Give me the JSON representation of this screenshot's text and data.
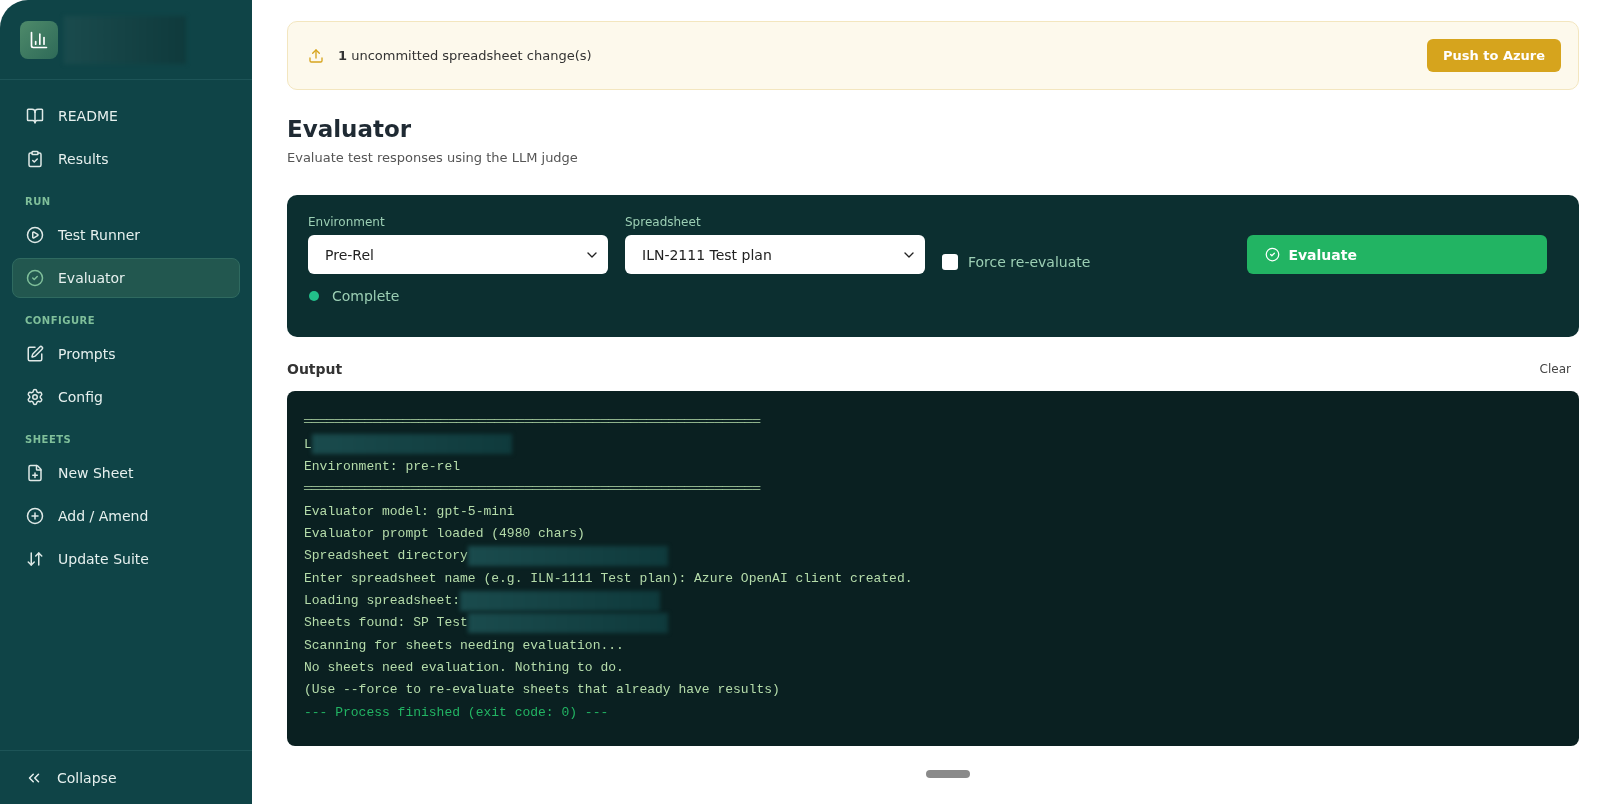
{
  "sidebar": {
    "sections": [
      {
        "items": [
          {
            "label": "README",
            "selected": false
          },
          {
            "label": "Results",
            "selected": false
          }
        ]
      },
      {
        "heading": "RUN",
        "items": [
          {
            "label": "Test Runner",
            "selected": false
          },
          {
            "label": "Evaluator",
            "selected": true
          }
        ]
      },
      {
        "heading": "CONFIGURE",
        "items": [
          {
            "label": "Prompts",
            "selected": false
          },
          {
            "label": "Config",
            "selected": false
          }
        ]
      },
      {
        "heading": "SHEETS",
        "items": [
          {
            "label": "New Sheet",
            "selected": false
          },
          {
            "label": "Add / Amend",
            "selected": false
          },
          {
            "label": "Update Suite",
            "selected": false
          }
        ]
      }
    ],
    "collapse": "Collapse"
  },
  "banner": {
    "count": "1",
    "text": "uncommitted spreadsheet change(s)",
    "button": "Push to Azure"
  },
  "page": {
    "title": "Evaluator",
    "subtitle": "Evaluate test responses using the LLM judge"
  },
  "controls": {
    "environment": {
      "label": "Environment",
      "value": "Pre-Rel"
    },
    "spreadsheet": {
      "label": "Spreadsheet",
      "value": "ILN-2111 Test plan"
    },
    "force": {
      "label": "Force re-evaluate",
      "checked": false
    },
    "button": "Evaluate",
    "status": {
      "text": "Complete",
      "color": "#22c08a"
    }
  },
  "output": {
    "label": "Output",
    "clear": "Clear",
    "lines": [
      {
        "kind": "rule",
        "text": "════════════════════════════════════════════════════════════"
      },
      {
        "kind": "text",
        "text": "L",
        "redacted": true
      },
      {
        "kind": "text",
        "text": "Environment: pre-rel"
      },
      {
        "kind": "rule",
        "text": "════════════════════════════════════════════════════════════"
      },
      {
        "kind": "text",
        "text": "Evaluator model: gpt-5-mini"
      },
      {
        "kind": "text",
        "text": "Evaluator prompt loaded (4980 chars)"
      },
      {
        "kind": "text",
        "text": "Spreadsheet directory",
        "redacted": true
      },
      {
        "kind": "text",
        "text": "Enter spreadsheet name (e.g. ILN-1111 Test plan): Azure OpenAI client created."
      },
      {
        "kind": "text",
        "text": "Loading spreadsheet:",
        "redacted": true
      },
      {
        "kind": "text",
        "text": "Sheets found: SP Test",
        "redacted": true
      },
      {
        "kind": "text",
        "text": "Scanning for sheets needing evaluation..."
      },
      {
        "kind": "text",
        "text": "No sheets need evaluation. Nothing to do."
      },
      {
        "kind": "text",
        "text": "(Use --force to re-evaluate sheets that already have results)"
      },
      {
        "kind": "success",
        "text": "--- Process finished (exit code: 0) ---"
      }
    ]
  }
}
